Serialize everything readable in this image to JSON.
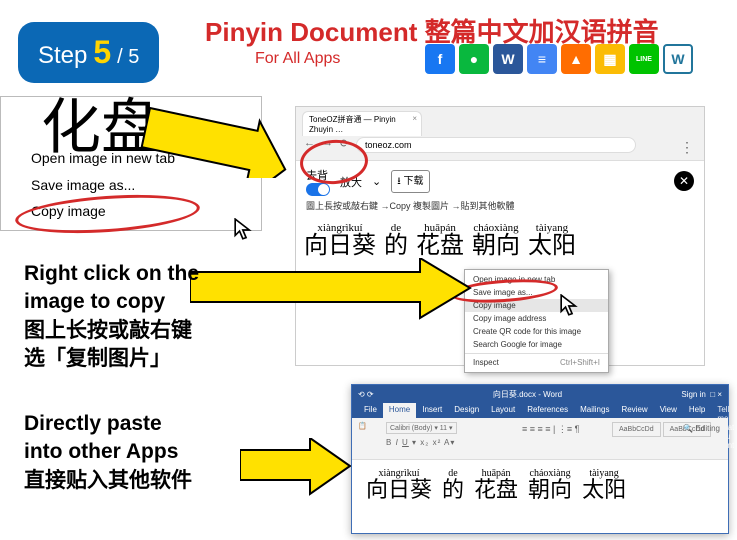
{
  "step": {
    "label": "Step",
    "num": "5",
    "total": "/ 5"
  },
  "title": "Pinyin Document 整篇中文加汉语拼音",
  "subtitle": "For All Apps",
  "icons": [
    "f",
    "●",
    "W",
    "≡",
    "▲",
    "▦",
    "LINE",
    "W"
  ],
  "pane1": {
    "big": "化盘",
    "menu": [
      "Open image in new tab",
      "Save image as...",
      "Copy image"
    ]
  },
  "pane2": {
    "tab_title": "ToneOZ拼音通 — Pinyin Zhuyin …",
    "url": "toneoz.com",
    "tool_qubei": "去背",
    "tool_fangda": "放大",
    "tool_dl": "下载",
    "hint": "圖上長按或敲右鍵 →Copy 複製圖片 →貼到其他軟體",
    "words": [
      {
        "p": "xiàngrìkuí",
        "h": "向日葵"
      },
      {
        "p": "de",
        "h": "的"
      },
      {
        "p": "huāpán",
        "h": "花盘"
      },
      {
        "p": "cháoxiàng",
        "h": "朝向"
      },
      {
        "p": "tàiyang",
        "h": "太阳"
      }
    ],
    "ctx": {
      "open": "Open image in new tab",
      "saveas": "Save image as...",
      "copy": "Copy image",
      "addr": "Copy image address",
      "qr": "Create QR code for this image",
      "search": "Search Google for image",
      "inspect": "Inspect",
      "kb": "Ctrl+Shift+I"
    }
  },
  "pane3": {
    "title_mid": "向日葵.docx - Word",
    "signin": "Sign in",
    "win": "□ ×",
    "tabs": {
      "file": "File",
      "home": "Home",
      "insert": "Insert",
      "design": "Design",
      "layout": "Layout",
      "ref": "References",
      "mail": "Mailings",
      "review": "Review",
      "view": "View",
      "help": "Help",
      "tell": "Tell me what you want to do"
    },
    "words": [
      {
        "p": "xiàngrìkuí",
        "h": "向日葵"
      },
      {
        "p": "de",
        "h": "的"
      },
      {
        "p": "huāpán",
        "h": "花盘"
      },
      {
        "p": "cháoxiàng",
        "h": "朝向"
      },
      {
        "p": "tàiyang",
        "h": "太阳"
      }
    ]
  },
  "instr1": "Right click on the\nimage to copy\n图上长按或敲右键\n选「复制图片」",
  "instr2": "Directly paste\ninto other Apps\n直接贴入其他软件"
}
